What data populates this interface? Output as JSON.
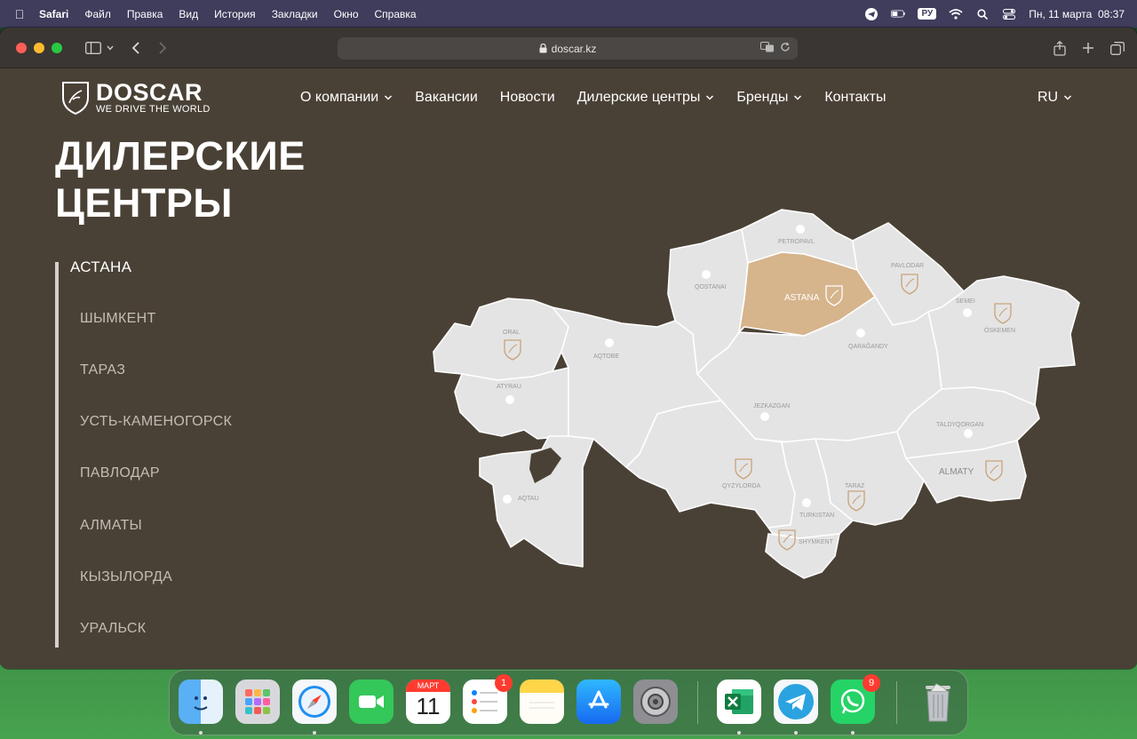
{
  "menubar": {
    "app": "Safari",
    "items": [
      "Файл",
      "Правка",
      "Вид",
      "История",
      "Закладки",
      "Окно",
      "Справка"
    ],
    "input_lang": "РУ",
    "datetime": "Пн, 11 марта  08:37"
  },
  "browser": {
    "url": "doscar.kz"
  },
  "site": {
    "logo_name": "DOSCAR",
    "logo_tagline": "WE DRIVE THE WORLD",
    "nav": [
      "О компании",
      "Вакансии",
      "Новости",
      "Дилерские центры",
      "Бренды",
      "Контакты"
    ],
    "lang": "RU"
  },
  "page": {
    "title_line1": "ДИЛЕРСКИЕ",
    "title_line2": "ЦЕНТРЫ",
    "cities": [
      "АСТАНА",
      "ШЫМКЕНТ",
      "ТАРАЗ",
      "УСТЬ-КАМЕНОГОРСК",
      "ПАВЛОДАР",
      "АЛМАТЫ",
      "КЫЗЫЛОРДА",
      "УРАЛЬСК"
    ],
    "active_city": "АСТАНА"
  },
  "map": {
    "labels": {
      "petropavl": "PETROPAVL",
      "qostanai": "QOSTANAI",
      "pavlodar": "PAVLODAR",
      "astana": "ASTANA",
      "semei": "SEMEI",
      "oskemen": "ÖSKEMEN",
      "oral": "ORAL",
      "aqtobe": "AQTOBE",
      "qaragandy": "QARAĞANDY",
      "atyrau": "ATYRAU",
      "zhezkazgan": "JEZKAZGAN",
      "taldyqorgan": "TALDYQORGAN",
      "almaty": "ALMATY",
      "aqtau": "AQTAU",
      "qyzylorda": "QYZYLORDA",
      "taraz": "TARAZ",
      "turkistan": "TURKISTAN",
      "shymkent": "SHYMKENT"
    },
    "colors": {
      "region": "#e4e4e4",
      "active": "#d6b48c",
      "border": "#ffffff",
      "marker": "#c9a27a"
    }
  },
  "dock": {
    "calendar_month": "МАРТ",
    "calendar_day": "11",
    "reminders_badge": "1",
    "whatsapp_badge": "9"
  }
}
